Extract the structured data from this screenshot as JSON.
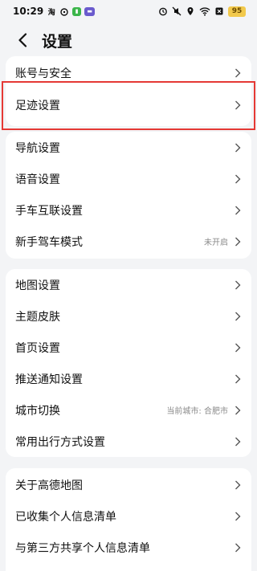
{
  "status_bar": {
    "time": "10:29",
    "battery": "95"
  },
  "header": {
    "title": "设置"
  },
  "groups": [
    {
      "items": [
        {
          "label": "账号与安全",
          "value": ""
        },
        {
          "label": "足迹设置",
          "value": ""
        }
      ]
    },
    {
      "items": [
        {
          "label": "导航设置",
          "value": ""
        },
        {
          "label": "语音设置",
          "value": ""
        },
        {
          "label": "手车互联设置",
          "value": ""
        },
        {
          "label": "新手驾车模式",
          "value": "未开启"
        }
      ]
    },
    {
      "items": [
        {
          "label": "地图设置",
          "value": ""
        },
        {
          "label": "主题皮肤",
          "value": ""
        },
        {
          "label": "首页设置",
          "value": ""
        },
        {
          "label": "推送通知设置",
          "value": ""
        },
        {
          "label": "城市切换",
          "value": "当前城市: 合肥市"
        },
        {
          "label": "常用出行方式设置",
          "value": ""
        }
      ]
    },
    {
      "items": [
        {
          "label": "关于高德地图",
          "value": ""
        },
        {
          "label": "已收集个人信息清单",
          "value": ""
        },
        {
          "label": "与第三方共享个人信息清单",
          "value": ""
        }
      ]
    }
  ],
  "colors": {
    "highlight": "#e53935",
    "background": "#f3f4f6",
    "card": "#ffffff"
  }
}
